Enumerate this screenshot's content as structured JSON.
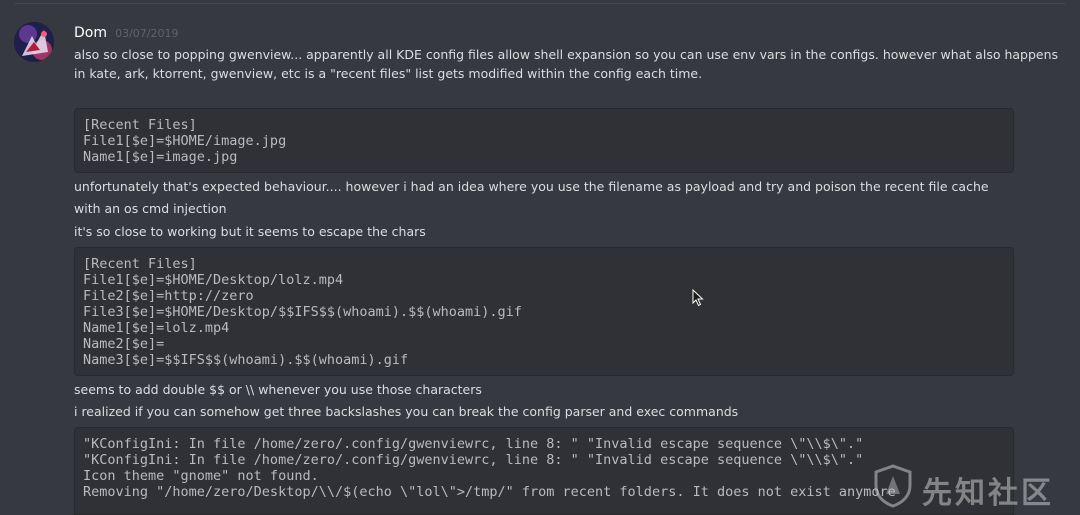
{
  "message": {
    "author": "Dom",
    "timestamp": "03/07/2019",
    "paragraph1": "also so close to popping gwenview... apparently all KDE config files allow shell expansion so you can use env vars in the configs. however what also happens in kate, ark, ktorrent, gwenview, etc is a \"recent files\" list gets modified within the config each time.",
    "code1": [
      "[Recent Files]",
      "File1[$e]=$HOME/image.jpg",
      "Name1[$e]=image.jpg"
    ],
    "paragraph2_line1": "unfortunately that's expected behaviour.... however i had an idea where you use the filename as payload and try and poison the recent file cache",
    "paragraph2_line2": "with an os cmd injection",
    "paragraph3": "it's so close to working but it seems to escape the chars",
    "code2": [
      "[Recent Files]",
      "File1[$e]=$HOME/Desktop/lolz.mp4",
      "File2[$e]=http://zero",
      "File3[$e]=$HOME/Desktop/$$IFS$$(whoami).$$(whoami).gif",
      "Name1[$e]=lolz.mp4",
      "Name2[$e]=",
      "Name3[$e]=$$IFS$$(whoami).$$(whoami).gif"
    ],
    "paragraph4": "seems to add double $$ or \\\\ whenever you use those characters",
    "paragraph5": "i realized if you can somehow get three backslashes you can break the config parser and exec commands",
    "code3": [
      "\"KConfigIni: In file /home/zero/.config/gwenviewrc, line 8: \" \"Invalid escape sequence \\\"\\\\$\\\".\"",
      "\"KConfigIni: In file /home/zero/.config/gwenviewrc, line 8: \" \"Invalid escape sequence \\\"\\\\$\\\".\"",
      "Icon theme \"gnome\" not found.",
      "Removing \"/home/zero/Desktop/\\\\/$(echo \\\"lol\\\">/tmp/\" from recent folders. It does not exist anymore"
    ]
  },
  "watermark": {
    "text": "先知社区"
  },
  "icons": {
    "avatar": "user-avatar",
    "cursor": "mouse-pointer-icon",
    "watermark_logo": "shield-logo-icon"
  },
  "colors": {
    "background": "#36393f",
    "code_background": "#2f3136",
    "text": "#dcddde",
    "code_text": "#b9bbbe",
    "username": "#ffffff",
    "timestamp": "#5f636a"
  }
}
